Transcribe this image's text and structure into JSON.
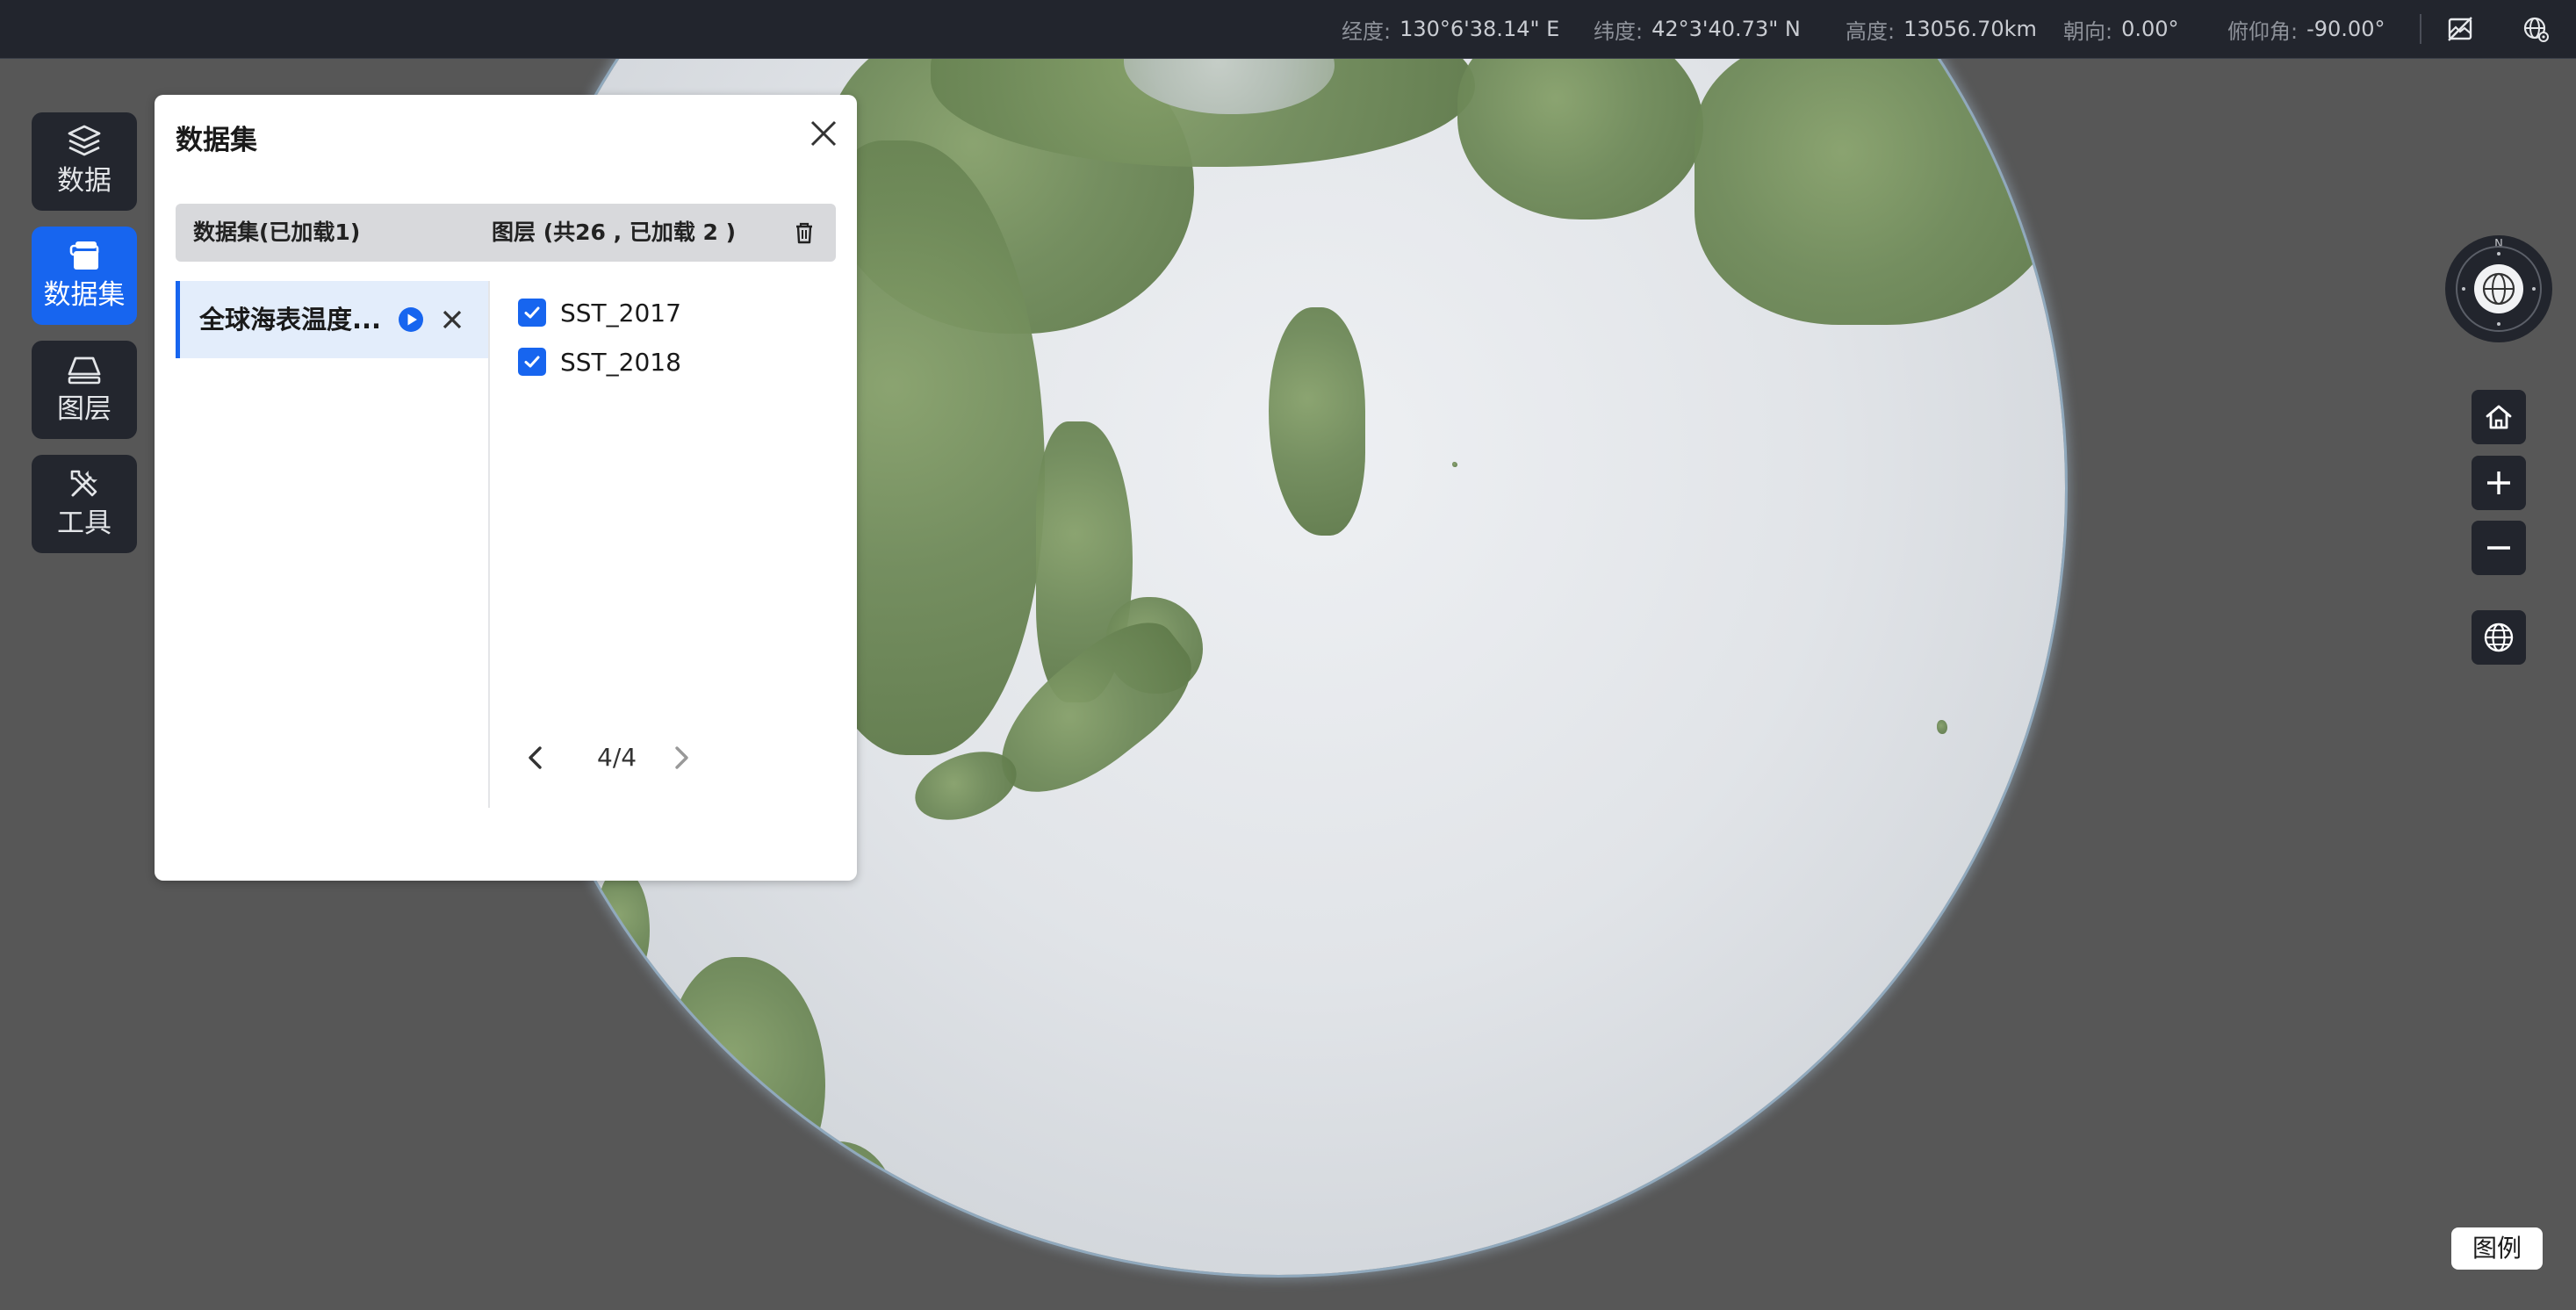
{
  "status_bar": {
    "longitude_label": "经度:",
    "longitude_value": "130°6'38.14\" E",
    "latitude_label": "纬度:",
    "latitude_value": "42°3'40.73\" N",
    "height_label": "高度:",
    "height_value": "13056.70km",
    "heading_label": "朝向:",
    "heading_value": "0.00°",
    "pitch_label": "俯仰角:",
    "pitch_value": "-90.00°",
    "icons": [
      "map-off-icon",
      "globe-settings-icon"
    ]
  },
  "sidebar": {
    "items": [
      {
        "label": "数据",
        "icon": "layers-icon",
        "active": false
      },
      {
        "label": "数据集",
        "icon": "dataset-icon",
        "active": true
      },
      {
        "label": "图层",
        "icon": "layer-plane-icon",
        "active": false
      },
      {
        "label": "工具",
        "icon": "tools-icon",
        "active": false
      }
    ]
  },
  "panel": {
    "title": "数据集",
    "header_left": "数据集(已加载1)",
    "header_right": "图层 (共26 , 已加载 2 )",
    "dataset": {
      "name": "全球海表温度...",
      "selected": true
    },
    "layers": [
      {
        "name": "SST_2017",
        "checked": true
      },
      {
        "name": "SST_2018",
        "checked": true
      }
    ],
    "pagination": "4/4"
  },
  "map_controls": {
    "compass_north": "N",
    "buttons": [
      "home-icon",
      "zoom-in-icon",
      "zoom-out-icon",
      "globe-icon"
    ]
  },
  "legend_button": "图例",
  "colors": {
    "accent": "#1765ef",
    "bar_bg": "#22252d",
    "background": "#575757"
  }
}
